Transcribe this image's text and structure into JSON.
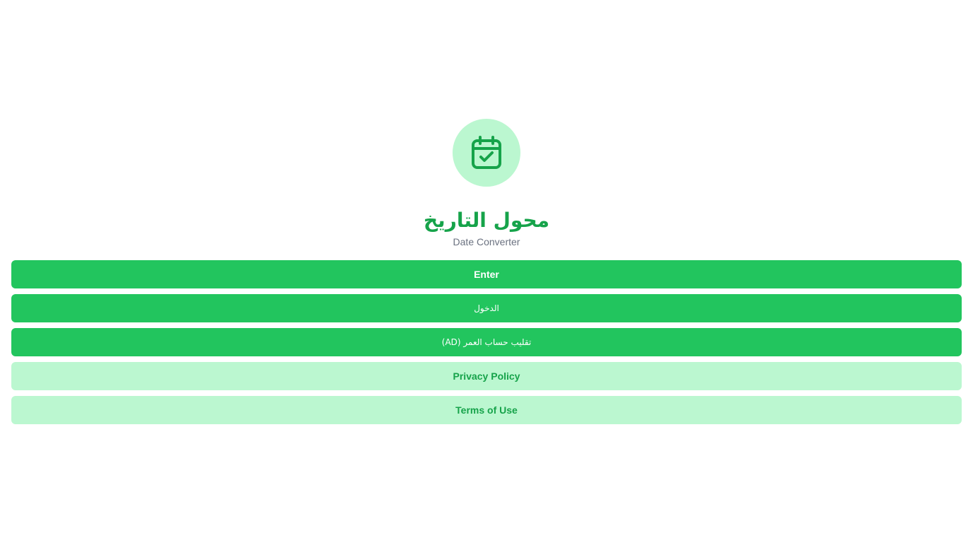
{
  "app": {
    "logo_icon": "calendar-check-icon",
    "title": "محول التاريخ",
    "subtitle": "Date Converter"
  },
  "buttons": {
    "enter_label": "Enter",
    "login_label": "الدخول",
    "age_label": "تقليب حساب العمر (AD)",
    "privacy_label": "Privacy Policy",
    "terms_label": "Terms of Use"
  },
  "colors": {
    "accent": "#22c55e",
    "accent_dark": "#16a34a",
    "accent_light": "#bbf7d0",
    "subtitle_gray": "#6b7280",
    "background": "#ffffff"
  }
}
